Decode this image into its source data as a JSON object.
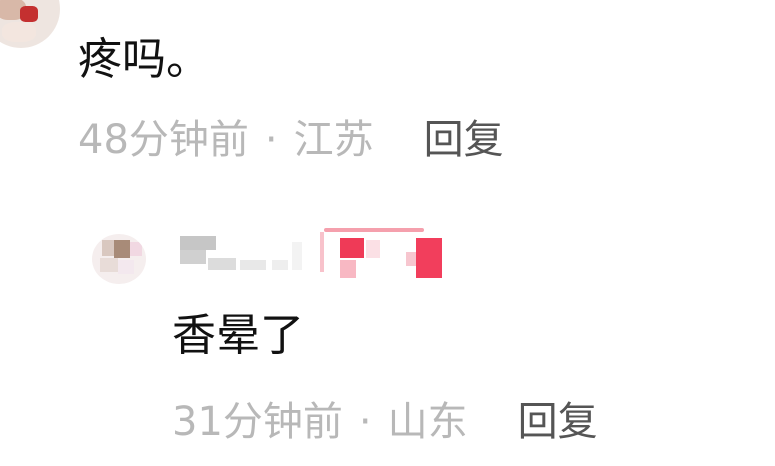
{
  "comments": [
    {
      "text": "疼吗。",
      "time": "48分钟前",
      "separator": "·",
      "location": "江苏",
      "reply_label": "回复"
    },
    {
      "text": "香晕了",
      "time": "31分钟前",
      "separator": "·",
      "location": "山东",
      "reply_label": "回复"
    }
  ],
  "icons": {
    "top_avatar": "avatar-image",
    "reply_avatar": "avatar-image-pixelated",
    "badge": "user-badge-pixelated"
  },
  "colors": {
    "text": "#111111",
    "meta": "#b8b8b8",
    "reply_button": "#555555",
    "badge_accent": "#f23e5c"
  }
}
